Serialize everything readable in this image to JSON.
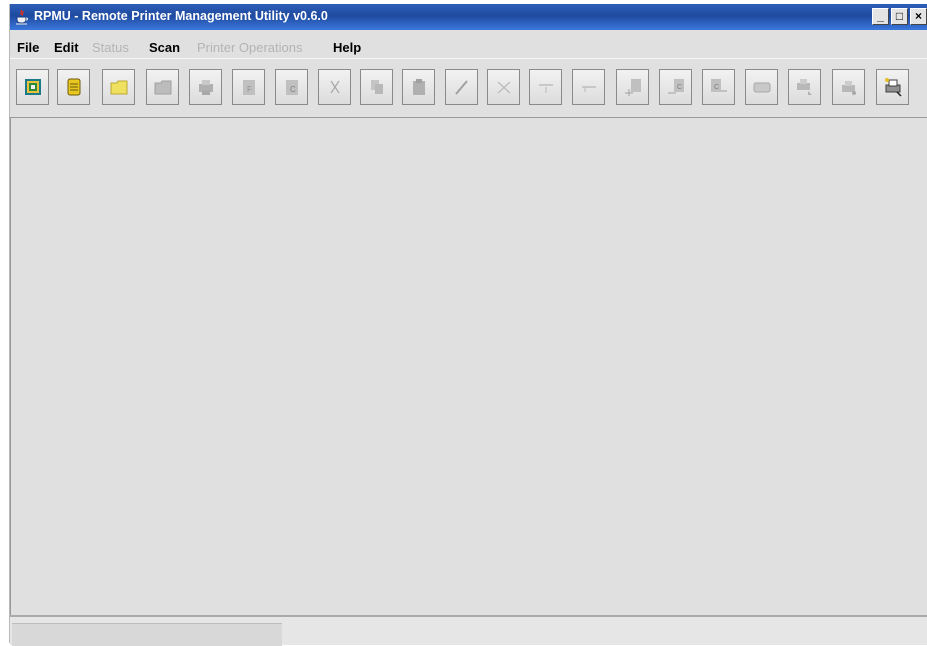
{
  "window": {
    "title": "RPMU - Remote Printer Management Utility v0.6.0",
    "controls": [
      "_",
      "□",
      "×"
    ]
  },
  "menu": [
    {
      "label": "File",
      "enabled": true
    },
    {
      "label": "Edit",
      "enabled": true
    },
    {
      "label": "Status",
      "enabled": false
    },
    {
      "label": "Scan",
      "enabled": true
    },
    {
      "label": "Printer Operations",
      "enabled": false
    },
    {
      "label": "Help",
      "enabled": true
    }
  ],
  "toolbar": [
    {
      "icon": "network-printer-icon",
      "enabled": true
    },
    {
      "icon": "printer-list-icon",
      "enabled": true
    },
    {
      "icon": "open-folder-icon",
      "enabled": true
    },
    {
      "icon": "folder-icon",
      "enabled": false
    },
    {
      "icon": "printer-status-icon",
      "enabled": false
    },
    {
      "icon": "file-f-icon",
      "enabled": false
    },
    {
      "icon": "file-c-icon",
      "enabled": false
    },
    {
      "icon": "cut-icon",
      "enabled": false
    },
    {
      "icon": "copy-icon",
      "enabled": false
    },
    {
      "icon": "paste-icon",
      "enabled": false
    },
    {
      "icon": "edit-pencil-icon",
      "enabled": false
    },
    {
      "icon": "delete-x-icon",
      "enabled": false
    },
    {
      "icon": "insert-down-icon",
      "enabled": false
    },
    {
      "icon": "insert-up-icon",
      "enabled": false
    },
    {
      "icon": "upload-f-icon",
      "enabled": false
    },
    {
      "icon": "upload-c-icon",
      "enabled": false
    },
    {
      "icon": "download-c-icon",
      "enabled": false
    },
    {
      "icon": "display-panel-icon",
      "enabled": false
    },
    {
      "icon": "printer-reset-icon",
      "enabled": false
    },
    {
      "icon": "printer-config-icon",
      "enabled": false
    },
    {
      "icon": "printer-scan-icon",
      "enabled": true
    }
  ],
  "colors": {
    "titlebar": "#1e4aa0",
    "background": "#e0e0e0",
    "disabled_text": "#b4b4b4"
  }
}
